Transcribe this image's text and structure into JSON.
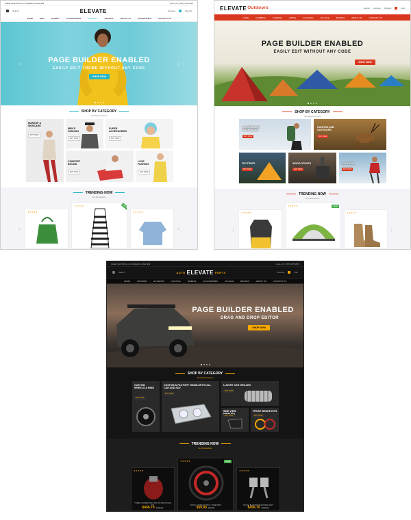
{
  "fashion": {
    "topbar_left": "FREE SHIPPING ON ORDERS OVER $99",
    "topbar_right": "CALL US: (555) 555 5555",
    "logo": "ELEVATE",
    "search": "Search",
    "account": "Account",
    "cart": "Cart (0)",
    "nav": [
      "HOME",
      "MEN",
      "WOMEN",
      "ACCESSORIES",
      "SPECIALS",
      "BRANDS",
      "ABOUT US",
      "OUR BRANDS",
      "CONTACT US"
    ],
    "hero_title": "PAGE BUILDER ENABLED",
    "hero_sub": "EASILY EDIT THEME WITHOUT ANY CODE",
    "hero_button": "SHOP NOW",
    "category_title": "SHOP BY CATEGORY",
    "category_sub": "Trending Products",
    "categories": [
      {
        "label": "MAKEUP & SKINCARE",
        "button": "BUY NOW"
      },
      {
        "label": "MEN'S FASHION",
        "button": "BUY NOW"
      },
      {
        "label": "SUPER ACCESSORIES",
        "button": "BUY NOW"
      },
      {
        "label": "COMFORT BOUND",
        "button": "BUY NOW"
      },
      {
        "label": "LOVE FASHION",
        "button": "BUY NOW"
      }
    ],
    "trending_title": "TRENDING NOW",
    "trending_sub": "Our Bestsellers",
    "stars": "★★★★★",
    "badge": "SALE"
  },
  "outdoors": {
    "logo": "ELEVATE",
    "logo_sub": "Outdoors",
    "search": "Search",
    "account": "Account",
    "wishlist": "Wishlist",
    "cart": "Cart",
    "nav": [
      "HOME",
      "CLIMBING",
      "CAMPING",
      "HIKING",
      "CLOTHING",
      "ON SALE",
      "BRANDS",
      "ABOUT US",
      "CONTACT US"
    ],
    "hero_title": "PAGE BUILDER ENABLED",
    "hero_sub": "EASILY EDIT WITHOUT ANY CODE",
    "hero_button": "SHOP NOW",
    "category_title": "SHOP BY CATEGORY",
    "category_sub": "Trending Products",
    "categories": [
      {
        "label": "LIGHTWEIGHT BACKPACKS",
        "button": "BUY NOW"
      },
      {
        "label": "HUNTING AND OUTDOORS",
        "button": "BUY NOW"
      },
      {
        "label": "TIPI TENTS",
        "button": "BUY NOW"
      },
      {
        "label": "WOOD STOVES",
        "button": "BUY NOW"
      },
      {
        "label": "CLOTHING",
        "button": "BUY NOW"
      }
    ],
    "trending_title": "TRENDING NOW",
    "trending_sub": "Our Bestsellers",
    "stars": "★★★★★",
    "badge": "SALE"
  },
  "auto": {
    "topbar_left": "FREE SHIPPING ON ORDERS OVER $99",
    "topbar_right": "CALL US: (555) 555 5555",
    "logo_pre": "AUTO",
    "logo": "ELEVATE",
    "logo_post": "PARTS",
    "search": "Search",
    "account": "Account",
    "cart": "Cart",
    "nav": [
      "HOME",
      "INTERIOR",
      "EXTERIOR",
      "LIGHTING",
      "WHEELS",
      "ACCESSORIES",
      "ON SALE",
      "BRANDS",
      "ABOUT US",
      "CONTACT US"
    ],
    "hero_title": "PAGE BUILDER ENABLED",
    "hero_sub": "DRAG AND DROP EDITOR",
    "hero_button": "SHOP NOW",
    "category_title": "SHOP BY CATEGORY",
    "category_sub": "Trending Products",
    "categories": [
      {
        "label": "CUSTOM WHEELS & RIMS",
        "button": "BUY NOW"
      },
      {
        "label": "CUSTOM & FACTORY HEADLIGHTS ALL CAR AND SUV",
        "button": "BUY NOW"
      },
      {
        "label": "LUXURY CAR GRILLES",
        "button": "BUY NOW"
      },
      {
        "label": "SIDE VIEW MIRRORS",
        "button": "BUY NOW"
      },
      {
        "label": "FRONT BRAKE KITS",
        "button": "BUY NOW"
      }
    ],
    "trending_title": "TRENDING NOW",
    "trending_sub": "Our Bestsellers",
    "stars": "★★★★★",
    "badge": "SALE",
    "products": [
      {
        "name": "TURBO CONNECTION, DRY FILTER INTAKE KIT",
        "price": "$456.70",
        "old": "$499.00"
      },
      {
        "name": "SASSY, LOOKS FIT BULL TONE RIMS",
        "price": "$59.95",
        "old": "$79.95"
      },
      {
        "name": "JOYCE, BLUE BISON ENGINE SHIFT",
        "price": "$456.70",
        "old": "$499.00"
      }
    ]
  },
  "colors": {
    "fashion_accent": "#29b6c7",
    "outdoors_accent": "#d9381e",
    "auto_accent": "#f7a800"
  }
}
